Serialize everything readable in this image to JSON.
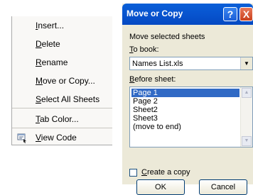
{
  "context_menu": {
    "items": [
      {
        "text": "Insert...",
        "accel": "I",
        "rest": "nsert..."
      },
      {
        "text": "Delete",
        "accel": "D",
        "rest": "elete"
      },
      {
        "text": "Rename",
        "accel": "R",
        "rest": "ename"
      },
      {
        "text": "Move or Copy...",
        "accel": "M",
        "rest": "ove or Copy..."
      },
      {
        "text": "Select All Sheets",
        "accel": "S",
        "rest": "elect All Sheets"
      },
      {
        "text": "Tab Color...",
        "accel": "T",
        "rest": "ab Color..."
      },
      {
        "text": "View Code",
        "accel": "V",
        "rest": "iew Code"
      }
    ]
  },
  "dialog": {
    "title": "Move or Copy",
    "help_glyph": "?",
    "close_glyph": "X",
    "subtitle": "Move selected sheets",
    "to_book_label": {
      "accel": "T",
      "rest": "o book:"
    },
    "to_book_value": "Names List.xls",
    "before_sheet_label": {
      "accel": "B",
      "rest": "efore sheet:"
    },
    "sheets": [
      "Page 1",
      "Page 2",
      "Sheet2",
      "Sheet3",
      "(move to end)"
    ],
    "selected_sheet": "Page 1",
    "create_copy_label": {
      "accel": "C",
      "rest": "reate a copy"
    },
    "create_copy_checked": false,
    "ok_label": "OK",
    "cancel_label": "Cancel"
  },
  "colors": {
    "titlebar": "#0855d0",
    "selection": "#316ac5"
  },
  "icons": {
    "view_code": "view-code-icon",
    "dropdown": "chevron-down-icon",
    "help": "help-icon",
    "close": "close-icon"
  }
}
